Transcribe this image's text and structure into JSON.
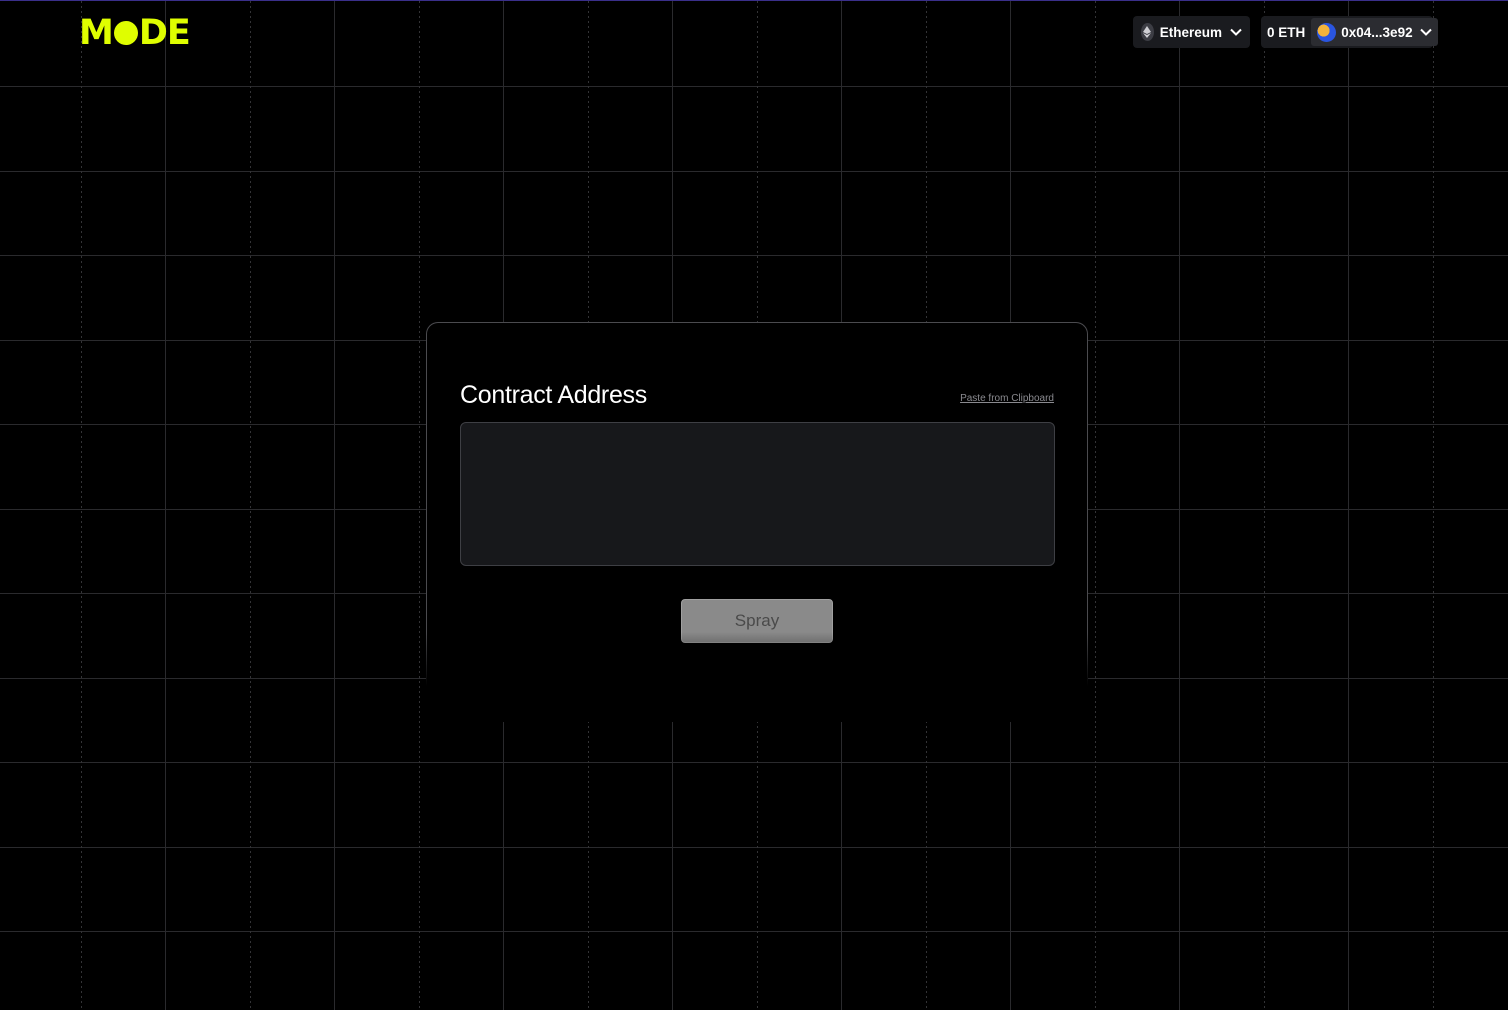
{
  "header": {
    "logo_text_left": "M",
    "logo_text_right": "DE",
    "logo_alt": "MODE",
    "network": {
      "label": "Ethereum",
      "icon": "ethereum-icon"
    },
    "account": {
      "balance": "0 ETH",
      "address": "0x04...3e92",
      "icon": "avatar-icon"
    }
  },
  "card": {
    "field_label": "Contract Address",
    "paste_link": "Paste from Clipboard",
    "input_value": "",
    "input_placeholder": "",
    "submit_label": "Spray"
  },
  "colors": {
    "brand": "#dffe00",
    "background": "#000000",
    "panel": "#1a1b1f",
    "button_disabled": "#8a8a8a"
  }
}
